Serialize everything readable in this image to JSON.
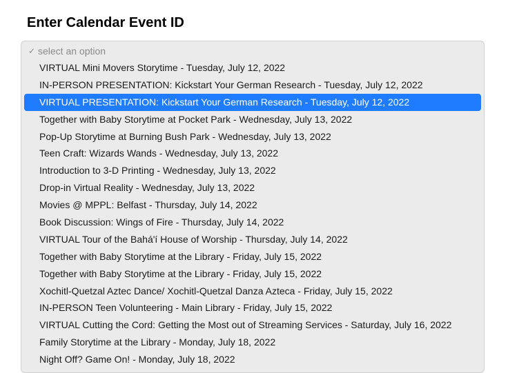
{
  "heading": "Enter Calendar Event ID",
  "dropdown": {
    "placeholder": "select an option",
    "highlighted_index": 2,
    "options": [
      "VIRTUAL Mini Movers Storytime - Tuesday, July 12, 2022",
      "IN-PERSON PRESENTATION: Kickstart Your German Research - Tuesday, July 12, 2022",
      "VIRTUAL PRESENTATION: Kickstart Your German Research - Tuesday, July 12, 2022",
      "Together with Baby Storytime at Pocket Park - Wednesday, July 13, 2022",
      "Pop-Up Storytime at Burning Bush Park - Wednesday, July 13, 2022",
      "Teen Craft: Wizards Wands - Wednesday, July 13, 2022",
      "Introduction to 3-D Printing - Wednesday, July 13, 2022",
      "Drop-in Virtual Reality - Wednesday, July 13, 2022",
      "Movies @ MPPL: Belfast - Thursday, July 14, 2022",
      "Book Discussion: Wings of Fire - Thursday, July 14, 2022",
      "VIRTUAL Tour of the Bahá'í House of Worship - Thursday, July 14, 2022",
      "Together with Baby Storytime at the Library - Friday, July 15, 2022",
      "Together with Baby Storytime at the Library - Friday, July 15, 2022",
      "Xochitl-Quetzal Aztec Dance/ Xochitl-Quetzal Danza Azteca - Friday, July 15, 2022",
      "IN-PERSON Teen Volunteering - Main Library - Friday, July 15, 2022",
      "VIRTUAL Cutting the Cord: Getting the Most out of Streaming Services - Saturday, July 16, 2022",
      "Family Storytime at the Library - Monday, July 18, 2022",
      "Night Off? Game On! - Monday, July 18, 2022"
    ]
  }
}
